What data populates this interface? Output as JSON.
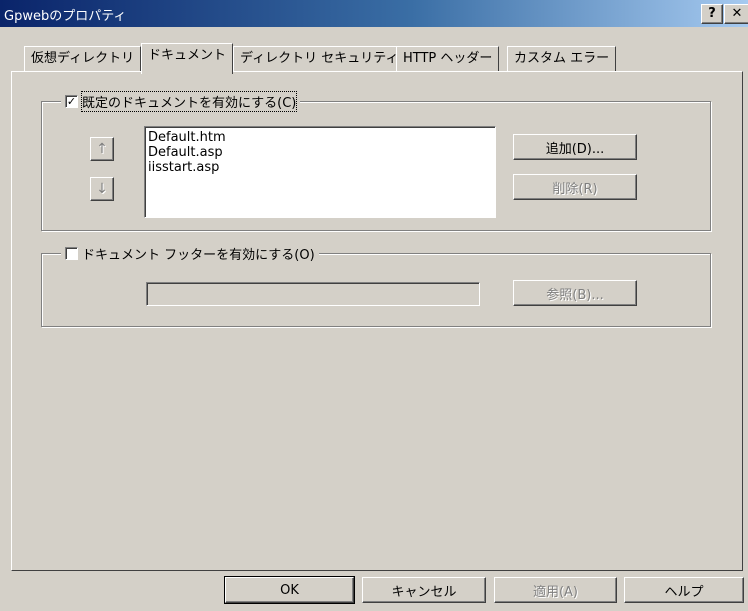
{
  "window": {
    "title": "Gpwebのプロパティ",
    "help_glyph": "?",
    "close_glyph": "✕"
  },
  "tabs": [
    {
      "label": "仮想ディレクトリ",
      "active": false
    },
    {
      "label": "ドキュメント",
      "active": true
    },
    {
      "label": "ディレクトリ セキュリティ",
      "active": false
    },
    {
      "label": "HTTP ヘッダー",
      "active": false
    },
    {
      "label": "カスタム エラー",
      "active": false
    }
  ],
  "default_docs": {
    "label": "既定のドキュメントを有効にする(C)",
    "checked": true,
    "check_glyph": "✓",
    "items": [
      "Default.htm",
      "Default.asp",
      "iisstart.asp"
    ],
    "move_up_glyph": "↑",
    "move_down_glyph": "↓",
    "add_label": "追加(D)...",
    "remove_label": "削除(R)"
  },
  "footer": {
    "label": "ドキュメント フッターを有効にする(O)",
    "checked": false,
    "path_value": "",
    "browse_label": "参照(B)..."
  },
  "buttons": {
    "ok": "OK",
    "cancel": "キャンセル",
    "apply": "適用(A)",
    "help": "ヘルプ"
  }
}
